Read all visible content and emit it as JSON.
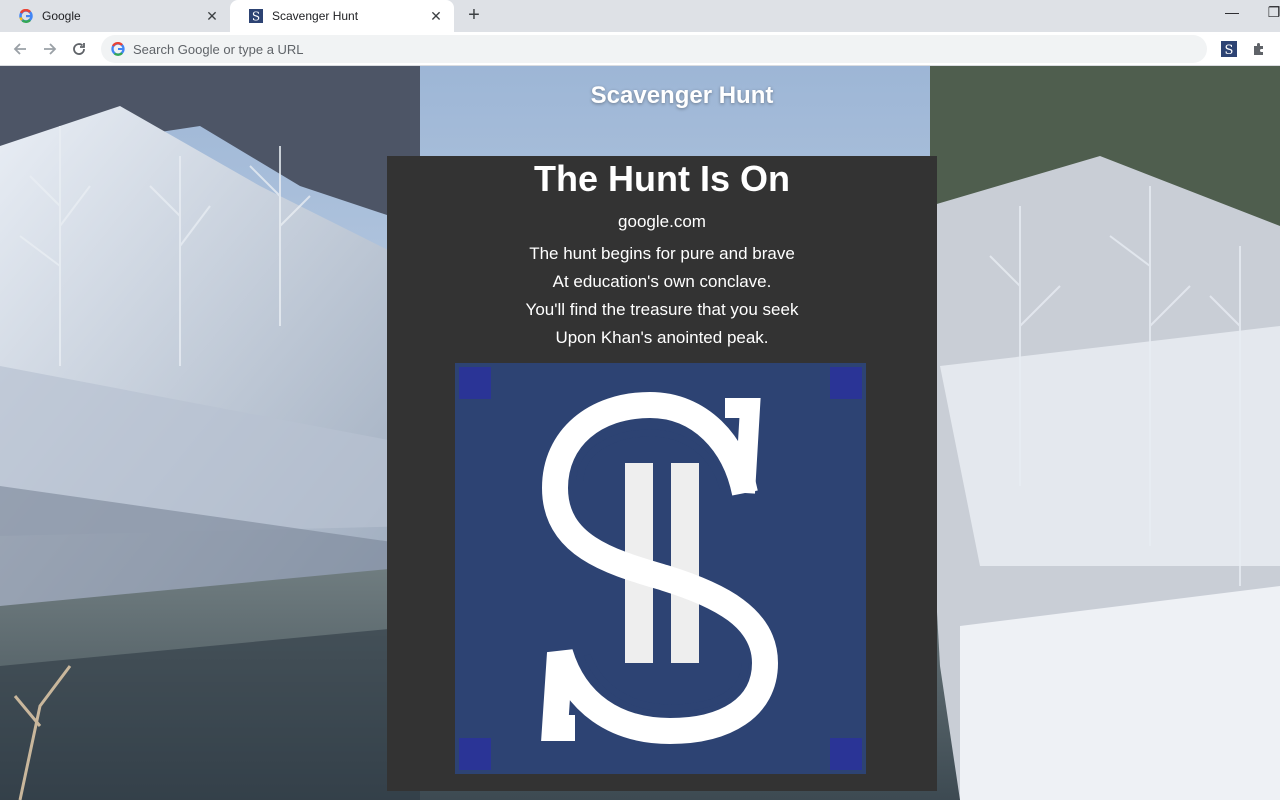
{
  "browser": {
    "tabs": [
      {
        "title": "Google",
        "favicon": "google-g-icon",
        "active": false
      },
      {
        "title": "Scavenger Hunt",
        "favicon": "scavenger-s-icon",
        "active": true
      }
    ],
    "omnibox_placeholder": "Search Google or type a URL"
  },
  "page": {
    "site_title": "Scavenger Hunt",
    "heading": "The Hunt Is On",
    "clue_site": "google.com",
    "poem_lines": [
      "The hunt begins for pure and brave",
      "At education's own conclave.",
      "You'll find the treasure that you seek",
      "Upon Khan's anointed peak."
    ],
    "logo_letter": "S",
    "colors": {
      "card_bg": "#333333",
      "logo_bg": "#2d4373",
      "logo_corner": "#2a3496",
      "text": "#ffffff"
    }
  }
}
